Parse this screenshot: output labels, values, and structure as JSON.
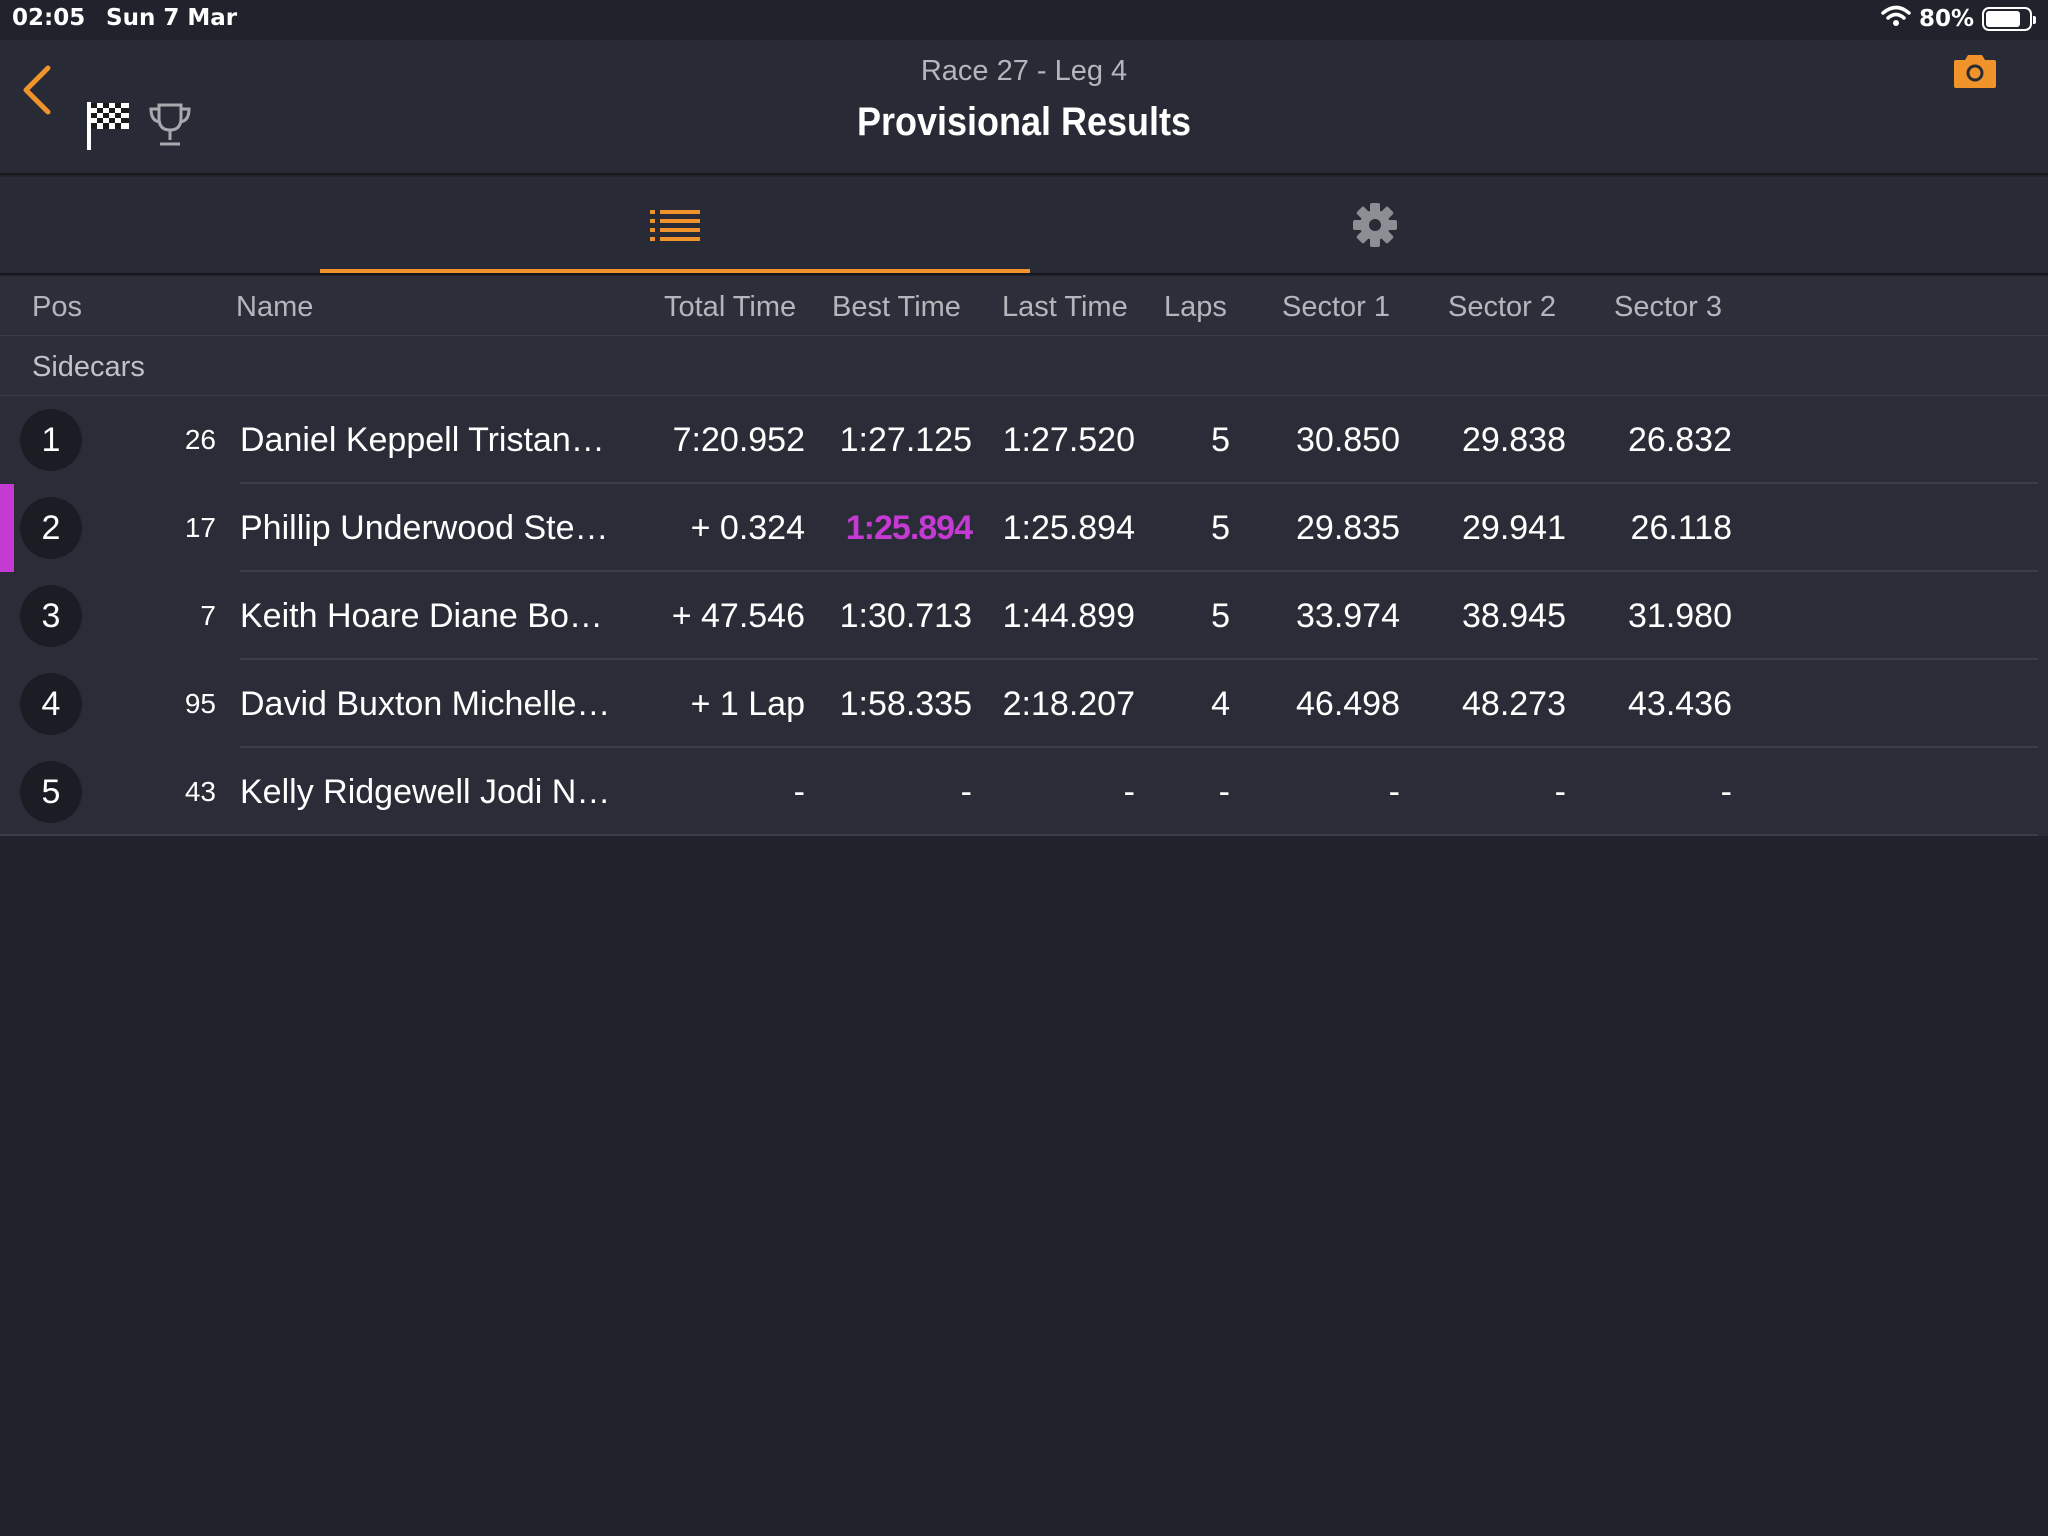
{
  "status_bar": {
    "time": "02:05",
    "date": "Sun 7 Mar",
    "battery": "80%",
    "battery_level": 0.8
  },
  "header": {
    "subtitle": "Race 27  -  Leg 4",
    "title": "Provisional Results"
  },
  "icons": {
    "back": "chevron-left-icon",
    "flag": "checkered-flag-icon",
    "trophy": "trophy-icon",
    "camera": "camera-icon",
    "list": "list-icon",
    "settings": "gear-icon",
    "wifi": "wifi-icon",
    "battery": "battery-icon"
  },
  "colors": {
    "accent": "#f0932b",
    "best_highlight": "#c43ad2",
    "background": "#20232c"
  },
  "columns": {
    "pos": "Pos",
    "name": "Name",
    "total": "Total Time",
    "best": "Best Time",
    "last": "Last Time",
    "laps": "Laps",
    "s1": "Sector 1",
    "s2": "Sector 2",
    "s3": "Sector 3"
  },
  "group": "Sidecars",
  "rows": [
    {
      "pos": "1",
      "num": "26",
      "name": "Daniel Keppell Tristan…",
      "total": "7:20.952",
      "best": "1:27.125",
      "last": "1:27.520",
      "laps": "5",
      "s1": "30.850",
      "s2": "29.838",
      "s3": "26.832"
    },
    {
      "pos": "2",
      "num": "17",
      "name": "Phillip Underwood Ste…",
      "total": "+ 0.324",
      "best": "1:25.894",
      "last": "1:25.894",
      "laps": "5",
      "s1": "29.835",
      "s2": "29.941",
      "s3": "26.118"
    },
    {
      "pos": "3",
      "num": "7",
      "name": "Keith Hoare Diane Bo…",
      "total": "+ 47.546",
      "best": "1:30.713",
      "last": "1:44.899",
      "laps": "5",
      "s1": "33.974",
      "s2": "38.945",
      "s3": "31.980"
    },
    {
      "pos": "4",
      "num": "95",
      "name": "David Buxton Michelle…",
      "total": "+ 1 Lap",
      "best": "1:58.335",
      "last": "2:18.207",
      "laps": "4",
      "s1": "46.498",
      "s2": "48.273",
      "s3": "43.436"
    },
    {
      "pos": "5",
      "num": "43",
      "name": "Kelly Ridgewell Jodi N…",
      "total": "-",
      "best": "-",
      "last": "-",
      "laps": "-",
      "s1": "-",
      "s2": "-",
      "s3": "-"
    }
  ]
}
